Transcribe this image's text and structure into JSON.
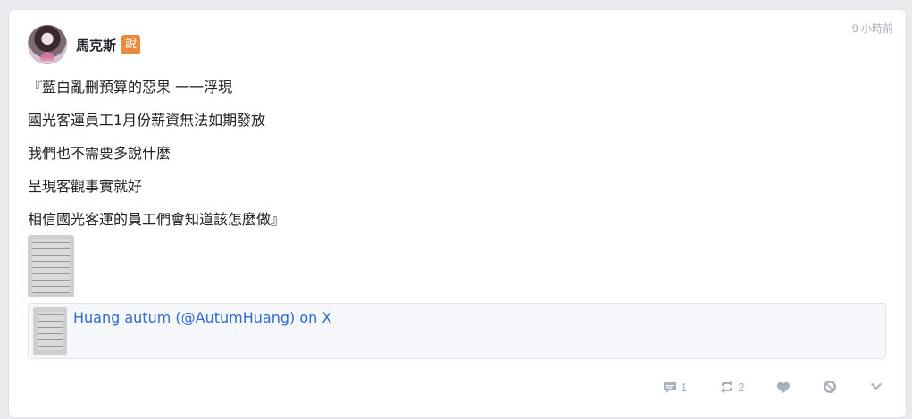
{
  "post": {
    "timestamp": "9 小時前",
    "author": "馬克斯",
    "badge": "說",
    "lines": [
      "『藍白亂刪預算的惡果 一一浮現",
      "國光客運員工1月份薪資無法如期發放",
      "我們也不需要多說什麼",
      "呈現客觀事實就好",
      "相信國光客運的員工們會知道該怎麼做』"
    ],
    "link_card": {
      "title": "Huang autum (@AutumHuang) on X"
    },
    "actions": {
      "comment_count": "1",
      "repost_count": "2"
    }
  },
  "colors": {
    "badge": "#e98a3f",
    "link": "#2d6cd0",
    "icons": "#a8b0bc"
  }
}
